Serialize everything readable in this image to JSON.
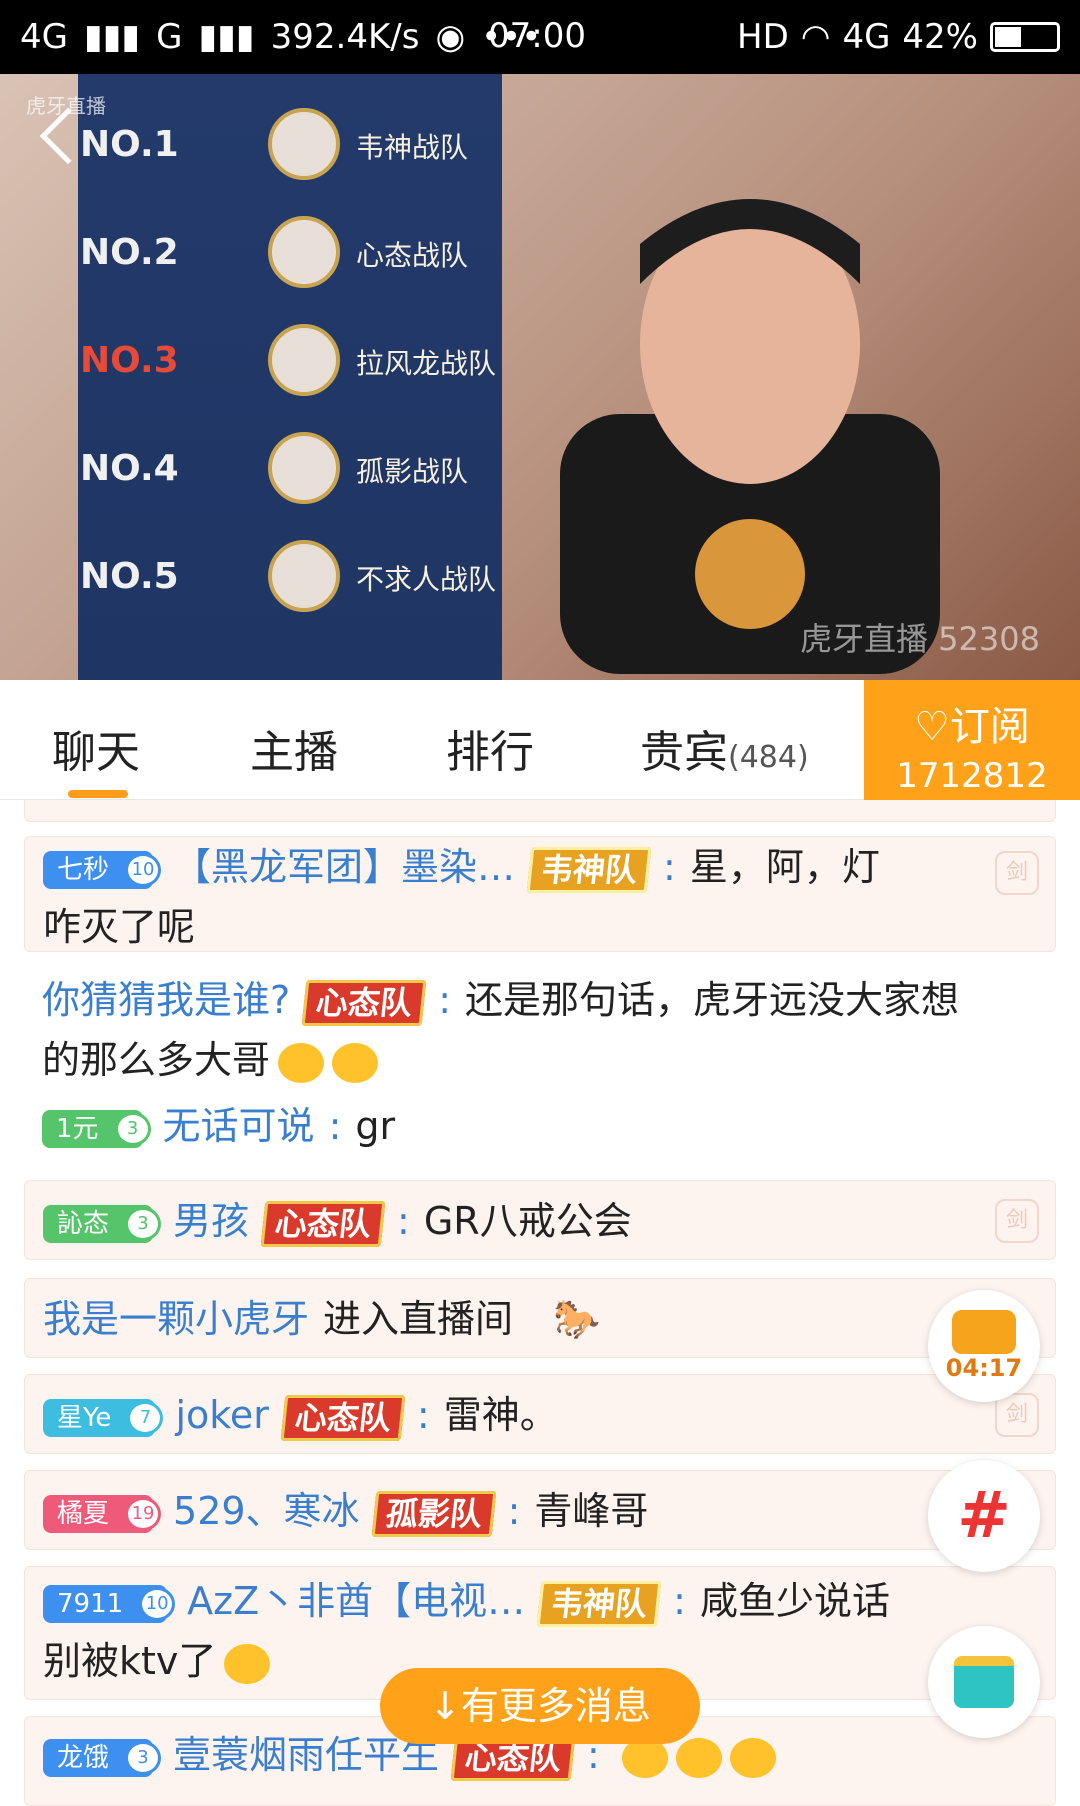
{
  "status_bar": {
    "network_left": "4G",
    "network_mid": "G",
    "speed": "392.4K/s",
    "dots": "•••",
    "time": "07:00",
    "hd": "HD",
    "network_right": "4G",
    "battery": "42%"
  },
  "video": {
    "logo_text": "虎牙直播",
    "watermark": "虎牙直播 52308",
    "rankings": [
      {
        "no": "NO.1",
        "team": "韦神战队"
      },
      {
        "no": "NO.2",
        "team": "心态战队"
      },
      {
        "no": "NO.3",
        "team": "拉风龙战队"
      },
      {
        "no": "NO.4",
        "team": "孤影战队"
      },
      {
        "no": "NO.5",
        "team": "不求人战队"
      }
    ]
  },
  "tabs": {
    "chat": "聊天",
    "anchor": "主播",
    "rank": "排行",
    "guests": "贵宾",
    "guests_count": "(484)"
  },
  "subscribe": {
    "label": "订阅",
    "count": "1712812"
  },
  "chat": [
    {
      "badge": "七秒",
      "level": "10",
      "badge_color": "#3d8ff0",
      "user": "【黑龙军团】墨染…",
      "team": "韦神队",
      "team_style": "gold",
      "text": "星，阿，灯",
      "text2": "咋灭了呢"
    },
    {
      "user": "你猜猜我是谁?",
      "team": "心态队",
      "team_style": "red",
      "text": "还是那句话，虎牙远没大家想",
      "text2": "的那么多大哥"
    },
    {
      "badge": "1元",
      "level": "3",
      "badge_color": "#55c46a",
      "user": "无话可说",
      "text": "gr"
    },
    {
      "badge": "訫态",
      "level": "3",
      "badge_color": "#55c46a",
      "user": "男孩",
      "team": "心态队",
      "team_style": "red",
      "text": "GR八戒公会"
    },
    {
      "user": "我是一颗小虎牙",
      "text": "进入直播间"
    },
    {
      "badge": "星Ye",
      "level": "7",
      "badge_color": "#3dbde0",
      "user": "joker",
      "team": "心态队",
      "team_style": "red",
      "text": "雷神。"
    },
    {
      "badge": "橘夏",
      "level": "19",
      "badge_color": "#f05a7a",
      "user": "529、寒冰",
      "team": "孤影队",
      "team_style": "red",
      "text": "青峰哥"
    },
    {
      "badge": "7911",
      "level": "10",
      "badge_color": "#3d8ff0",
      "user": "AzZ丶非酋【电视…",
      "team": "韦神队",
      "team_style": "gold",
      "text": "咸鱼少说话",
      "text2": "别被ktv了"
    },
    {
      "badge": "龙饿",
      "level": "3",
      "badge_color": "#3d8ff0",
      "user": "壹蓑烟雨任平生",
      "team": "心态队",
      "team_style": "red",
      "text": ""
    }
  ],
  "sword_label": "剑",
  "timer": "04:17",
  "hash_icon": "#",
  "more_messages": "有更多消息"
}
